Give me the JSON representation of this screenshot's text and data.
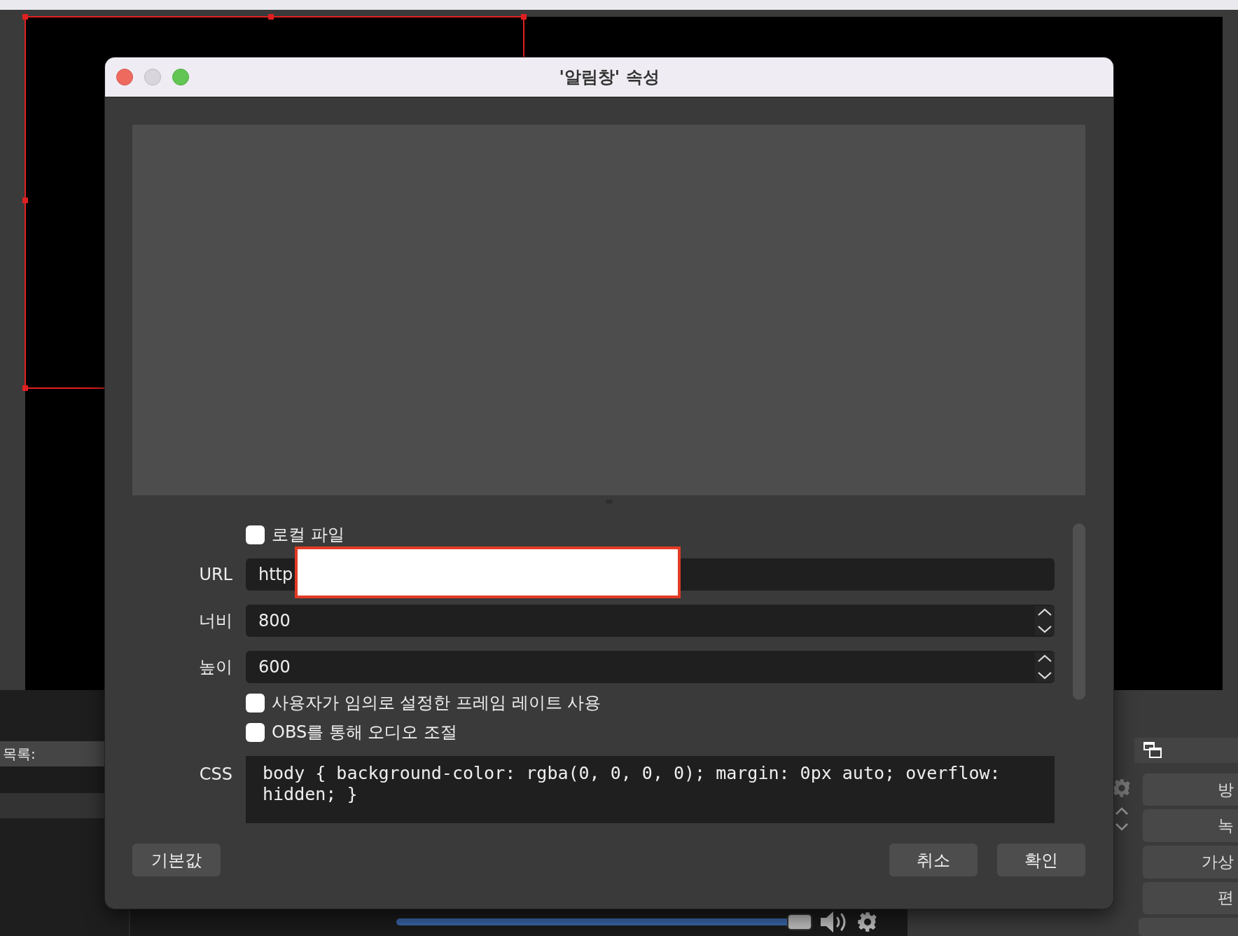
{
  "window": {
    "title": "'알림창' 속성"
  },
  "form": {
    "local_file": {
      "label": "로컬 파일",
      "checked": false
    },
    "url": {
      "label": "URL",
      "value": "http"
    },
    "width": {
      "label": "너비",
      "value": "800"
    },
    "height": {
      "label": "높이",
      "value": "600"
    },
    "options": [
      {
        "label": "사용자가 임의로 설정한 프레임 레이트 사용",
        "checked": false
      },
      {
        "label": "OBS를 통해 오디오 조절",
        "checked": false
      }
    ],
    "css": {
      "label": "CSS",
      "value": "body { background-color: rgba(0, 0, 0, 0); margin: 0px auto; overflow: hidden; }"
    }
  },
  "buttons": {
    "defaults": "기본값",
    "cancel": "취소",
    "ok": "확인"
  },
  "background": {
    "list_header": "목록:",
    "volume": {
      "level": 1
    },
    "controls": [
      "방",
      "녹",
      "가상",
      "편"
    ]
  }
}
